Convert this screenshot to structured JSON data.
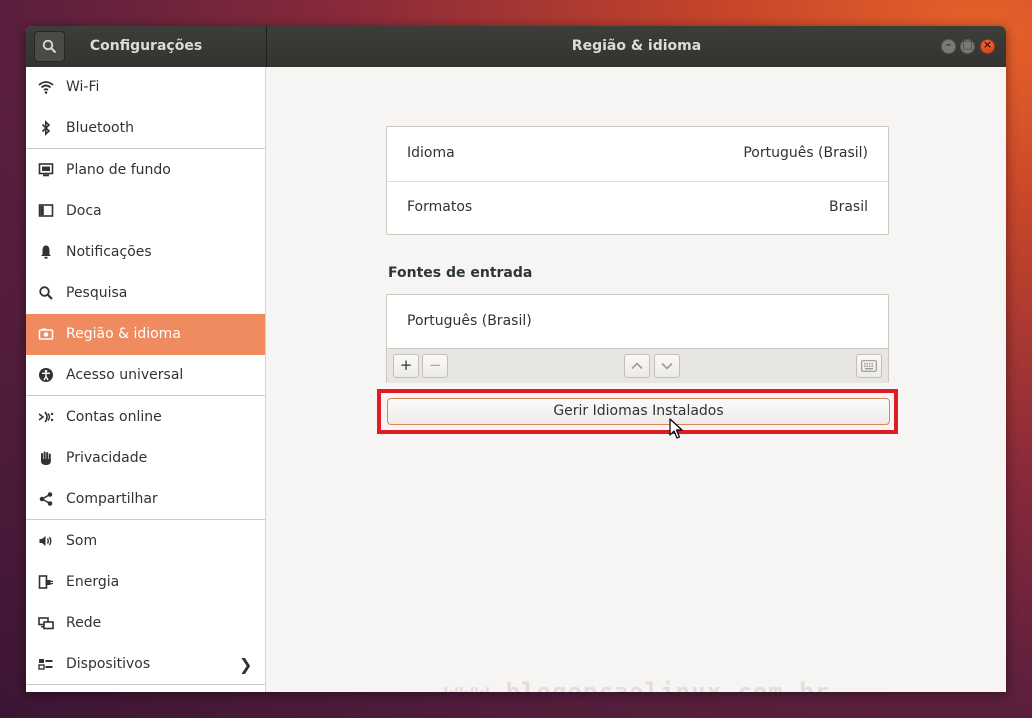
{
  "window": {
    "sidebar_title": "Configurações",
    "main_title": "Região & idioma",
    "controls": [
      "minimize-icon",
      "maximize-icon",
      "close-icon"
    ]
  },
  "sidebar": {
    "items": [
      {
        "label": "Wi-Fi",
        "icon": "wifi-icon"
      },
      {
        "label": "Bluetooth",
        "icon": "bluetooth-icon"
      },
      {
        "label": "Plano de fundo",
        "icon": "background-icon"
      },
      {
        "label": "Doca",
        "icon": "dock-icon"
      },
      {
        "label": "Notificações",
        "icon": "bell-icon"
      },
      {
        "label": "Pesquisa",
        "icon": "search-icon"
      },
      {
        "label": "Região & idioma",
        "icon": "camera-icon",
        "active": true
      },
      {
        "label": "Acesso universal",
        "icon": "accessibility-icon"
      },
      {
        "label": "Contas online",
        "icon": "online-accounts-icon"
      },
      {
        "label": "Privacidade",
        "icon": "hand-icon"
      },
      {
        "label": "Compartilhar",
        "icon": "share-icon"
      },
      {
        "label": "Som",
        "icon": "speaker-icon"
      },
      {
        "label": "Energia",
        "icon": "power-plug-icon"
      },
      {
        "label": "Rede",
        "icon": "network-icon"
      },
      {
        "label": "Dispositivos",
        "icon": "devices-icon",
        "chevron": true
      }
    ]
  },
  "main": {
    "language": {
      "label": "Idioma",
      "value": "Português (Brasil)"
    },
    "formats": {
      "label": "Formatos",
      "value": "Brasil"
    },
    "input_sources_title": "Fontes de entrada",
    "input_sources": [
      "Português (Brasil)"
    ],
    "toolbar": {
      "add": "+",
      "remove": "−"
    },
    "manage_button": "Gerir Idiomas Instalados"
  },
  "watermark": "www.blogopcaolinux.com.br",
  "colors": {
    "accent": "#f08a5f",
    "highlight_box": "#e01b24",
    "titlebar": "#3a3a37",
    "close_button": "#e95420"
  }
}
